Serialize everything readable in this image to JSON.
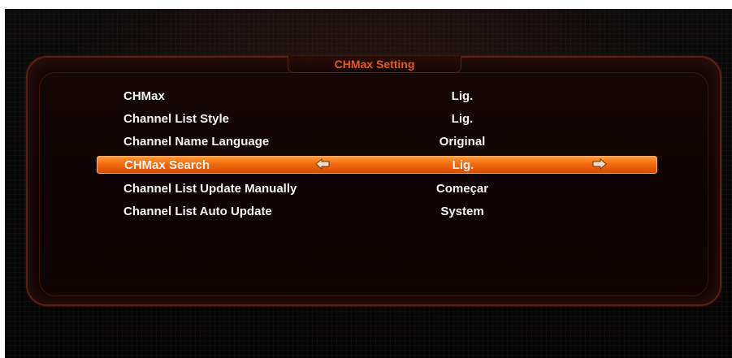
{
  "menu": {
    "title": "CHMax Setting",
    "items": [
      {
        "label": "CHMax",
        "value": "Lig."
      },
      {
        "label": "Channel List Style",
        "value": "Lig."
      },
      {
        "label": "Channel Name Language",
        "value": "Original"
      },
      {
        "label": "CHMax Search",
        "value": "Lig.",
        "selected": true
      },
      {
        "label": "Channel List Update Manually",
        "value": "Começar"
      },
      {
        "label": "Channel List Auto Update",
        "value": "System"
      }
    ]
  },
  "colors": {
    "accent": "#f26a0c",
    "title": "#e85a1a",
    "border": "#5a1f17"
  },
  "icons": {
    "left": "arrow-left-icon",
    "right": "arrow-right-icon"
  }
}
